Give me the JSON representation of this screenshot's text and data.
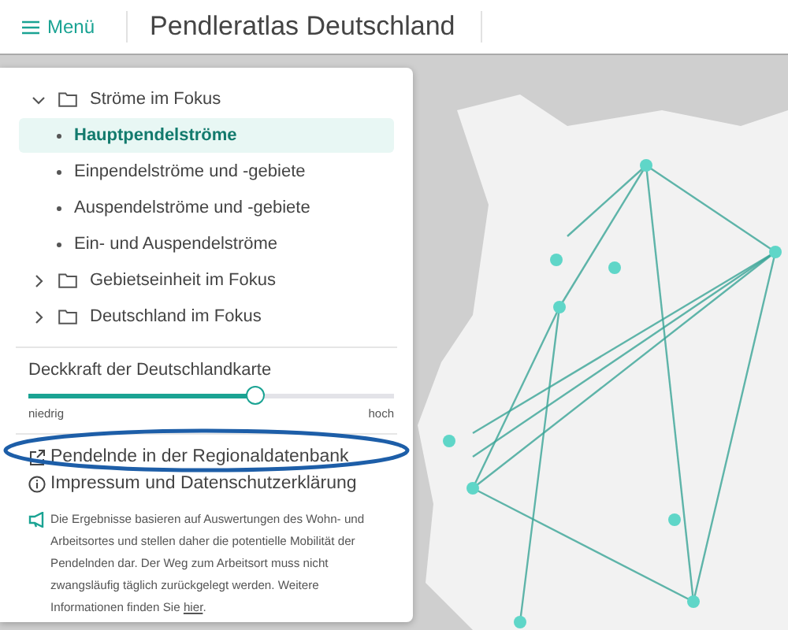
{
  "header": {
    "menu_label": "Menü",
    "title": "Pendleratlas Deutschland"
  },
  "tree": [
    {
      "label": "Ströme im Fokus",
      "expanded": true,
      "children": [
        {
          "label": "Hauptpendelströme",
          "selected": true
        },
        {
          "label": "Einpendelströme und -gebiete",
          "selected": false
        },
        {
          "label": "Auspendelströme und -gebiete",
          "selected": false
        },
        {
          "label": "Ein- und Auspendelströme",
          "selected": false
        }
      ]
    },
    {
      "label": "Gebietseinheit im Fokus",
      "expanded": false
    },
    {
      "label": "Deutschland im Fokus",
      "expanded": false
    }
  ],
  "opacity_slider": {
    "label": "Deckkraft der Deutschlandkarte",
    "level": 0.62,
    "min_label": "niedrig",
    "max_label": "hoch"
  },
  "links": [
    {
      "kind": "external",
      "label": "Pendelnde in der Regionaldatenbank"
    },
    {
      "kind": "info",
      "label": "Impressum und Datenschutzerklärung"
    }
  ],
  "notice": {
    "text": "Die Ergebnisse basieren auf Auswertungen des Wohn- und Arbeitsortes und stellen daher die potentielle Mobilität der Pendelnden dar. Der Weg zum Arbeitsort muss nicht zwangsläufig täglich zurückgelegt werden. Weitere Informationen finden Sie ",
    "link": "hier",
    "after": "."
  }
}
